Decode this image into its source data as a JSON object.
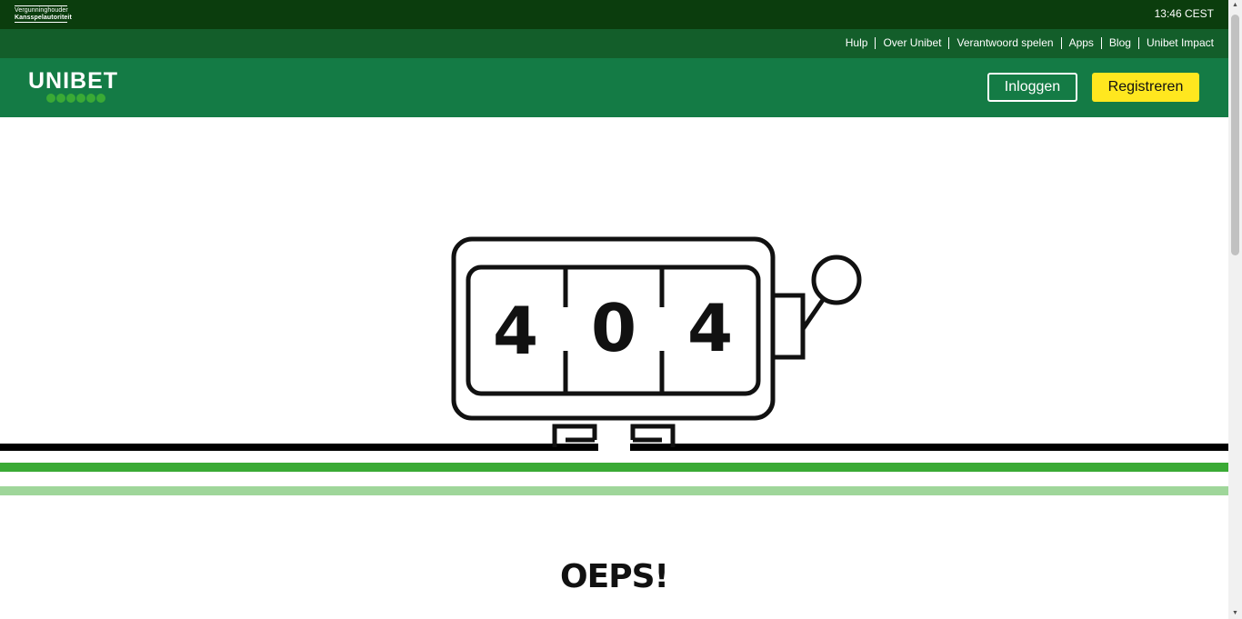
{
  "topbar": {
    "license_line1": "Vergunninghouder",
    "license_line2": "Kansspelautoriteit",
    "clock": "13:46 CEST"
  },
  "subnav": {
    "items": [
      {
        "label": "Hulp"
      },
      {
        "label": "Over Unibet"
      },
      {
        "label": "Verantwoord spelen"
      },
      {
        "label": "Apps"
      },
      {
        "label": "Blog"
      },
      {
        "label": "Unibet Impact"
      }
    ]
  },
  "header": {
    "logo_text": "UNIBET",
    "login_label": "Inloggen",
    "register_label": "Registreren"
  },
  "error": {
    "digit1": "4",
    "digit2": "0",
    "digit3": "4",
    "heading": "OEPS!"
  },
  "colors": {
    "topbar": "#0b3d0d",
    "subnav": "#135e2a",
    "header": "#147b45",
    "register_button": "#ffe71f",
    "stripe_green": "#3aaa35",
    "stripe_lightgreen": "#9fd69a"
  },
  "icons": {
    "slot_machine": "slot-machine-404-icon",
    "scroll_up": "scroll-up-arrow-icon",
    "scroll_down": "scroll-down-arrow-icon"
  }
}
